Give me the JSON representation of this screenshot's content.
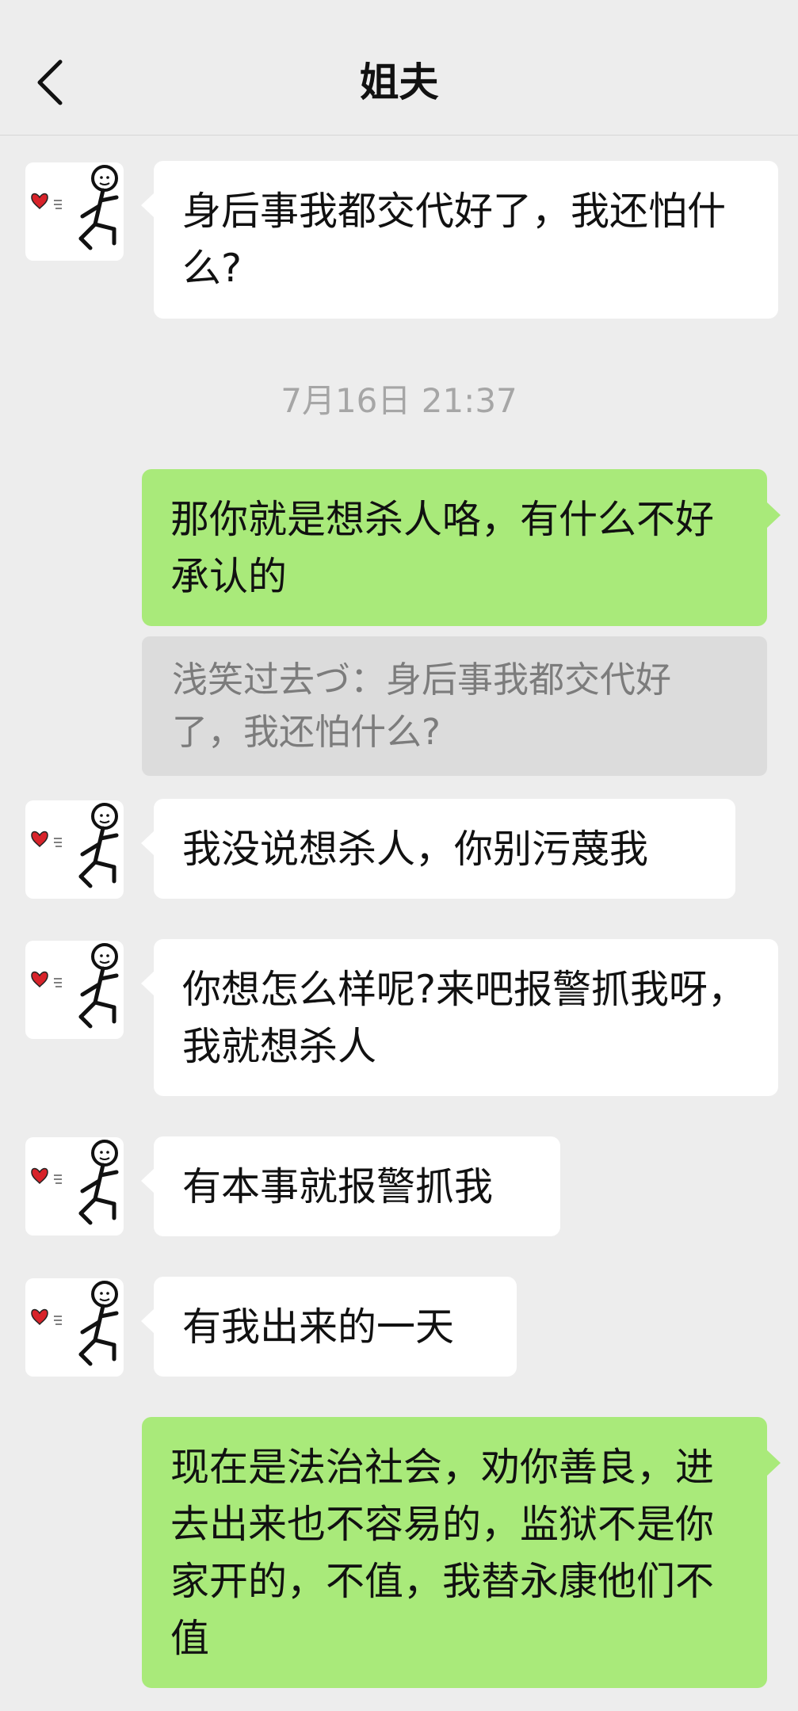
{
  "header": {
    "title": "姐夫",
    "back_icon": "chevron-left-icon"
  },
  "messages": [
    {
      "side": "in",
      "text": "身后事我都交代好了，我还怕什么?"
    },
    {
      "side": "out",
      "text": "那你就是想杀人咯，有什么不好承认的"
    },
    {
      "side": "in",
      "text": "我没说想杀人，你别污蔑我"
    },
    {
      "side": "in",
      "text": "你想怎么样呢?来吧报警抓我呀，我就想杀人"
    },
    {
      "side": "in",
      "text": "有本事就报警抓我"
    },
    {
      "side": "in",
      "text": "有我出来的一天"
    },
    {
      "side": "out",
      "text": "现在是法治社会，劝你善良，进去出来也不容易的，监狱不是你家开的，不值，我替永康他们不值"
    }
  ],
  "timestamp": "7月16日 21:37",
  "quote": {
    "text": "浅笑过去づ：身后事我都交代好了，我还怕什么?"
  },
  "avatar_icon": "stick-figure-heart-icon",
  "colors": {
    "background": "#ededed",
    "incoming_bubble": "#ffffff",
    "outgoing_bubble": "#a9ea7a",
    "quote_background": "#dcdcdc",
    "timestamp_text": "#a6a6a6"
  }
}
